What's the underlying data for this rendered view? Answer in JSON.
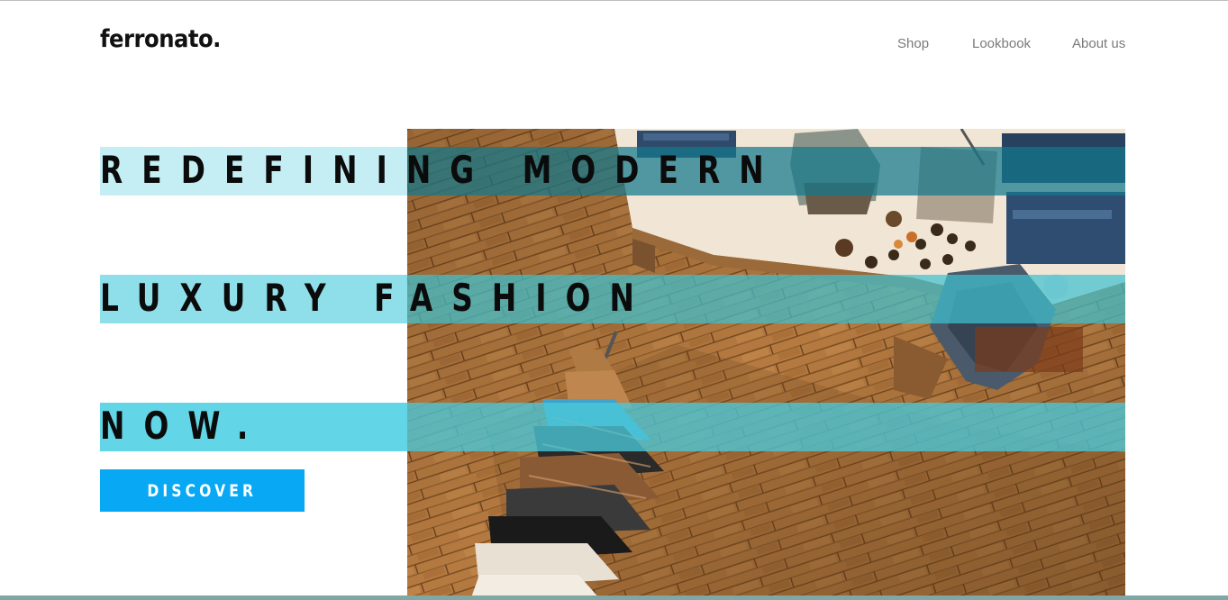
{
  "brand": {
    "logo_text": "ferronato."
  },
  "nav": {
    "items": [
      {
        "label": "Shop"
      },
      {
        "label": "Lookbook"
      },
      {
        "label": "About us"
      }
    ]
  },
  "hero": {
    "headline_lines": [
      "REDEFINING MODERN",
      "LUXURY FASHION",
      "NOW."
    ],
    "cta_label": "DISCOVER",
    "image_description_icon": "store-photo"
  },
  "colors": {
    "accent_button": "#08a8f4",
    "band_light": "#c4eef4",
    "band_mid": "#8fdfea",
    "band_strong": "#62d6e6",
    "text_dark": "#0b0b0b",
    "nav_text": "#7a7a7a"
  }
}
